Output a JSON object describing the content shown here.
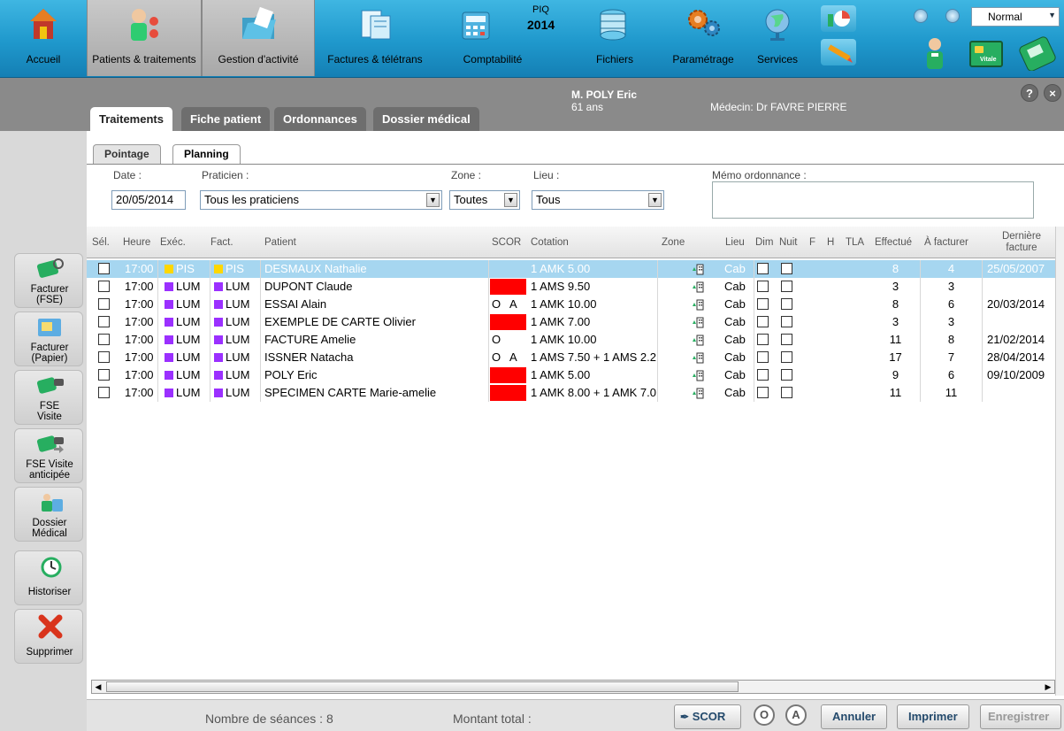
{
  "toolbar": {
    "items": [
      {
        "label": "Accueil"
      },
      {
        "label": "Patients & traitements"
      },
      {
        "label": "Gestion d'activité"
      },
      {
        "label": "Factures & télétrans"
      },
      {
        "label": "Comptabilité"
      },
      {
        "label": "Fichiers"
      },
      {
        "label": "Paramétrage"
      },
      {
        "label": "Services"
      }
    ],
    "piq_label": "PIQ",
    "piq_year": "2014",
    "mode": "Normal",
    "vitale_label": "Vitale"
  },
  "patient": {
    "name": "M. POLY Eric",
    "age": "61 ans",
    "doctor": "Médecin: Dr FAVRE PIERRE"
  },
  "header_buttons": {
    "help": "?",
    "close": "×"
  },
  "main_tabs": [
    {
      "label": "Traitements"
    },
    {
      "label": "Fiche patient"
    },
    {
      "label": "Ordonnances"
    },
    {
      "label": "Dossier médical"
    }
  ],
  "sub_tabs": [
    {
      "label": "Pointage"
    },
    {
      "label": "Planning"
    }
  ],
  "filters": {
    "date_label": "Date :",
    "date_value": "20/05/2014",
    "praticien_label": "Praticien :",
    "praticien_value": "Tous les praticiens",
    "zone_label": "Zone :",
    "zone_value": "Toutes",
    "lieu_label": "Lieu :",
    "lieu_value": "Tous",
    "memo_label": "Mémo ordonnance :"
  },
  "columns": {
    "sel": "Sél.",
    "heure": "Heure",
    "exec": "Exéc.",
    "fact": "Fact.",
    "patient": "Patient",
    "scor": "SCOR",
    "cotation": "Cotation",
    "zone": "Zone",
    "lieu": "Lieu",
    "dim": "Dim",
    "nuit": "Nuit",
    "f": "F",
    "h": "H",
    "tla": "TLA",
    "effectue": "Effectué",
    "a_facturer": "À facturer",
    "derniere_1": "Dernière",
    "derniere_2": "facture"
  },
  "rows": [
    {
      "heure": "17:00",
      "exec": "PIS",
      "fact": "PIS",
      "exec_color": "#ffd700",
      "patient": "DESMAUX Nathalie",
      "scor_o": "",
      "scor_a": "",
      "scor_red": false,
      "cotation": "1 AMK 5.00",
      "lieu": "Cab",
      "effectue": "8",
      "a_facturer": "4",
      "derniere": "25/05/2007",
      "selected": true
    },
    {
      "heure": "17:00",
      "exec": "LUM",
      "fact": "LUM",
      "exec_color": "#9b30ff",
      "patient": "DUPONT Claude",
      "scor_o": "",
      "scor_a": "",
      "scor_red": true,
      "cotation": "1 AMS 9.50",
      "lieu": "Cab",
      "effectue": "3",
      "a_facturer": "3",
      "derniere": "",
      "selected": false
    },
    {
      "heure": "17:00",
      "exec": "LUM",
      "fact": "LUM",
      "exec_color": "#9b30ff",
      "patient": "ESSAI Alain",
      "scor_o": "O",
      "scor_a": "A",
      "scor_red": false,
      "cotation": "1 AMK 10.00",
      "lieu": "Cab",
      "effectue": "8",
      "a_facturer": "6",
      "derniere": "20/03/2014",
      "selected": false
    },
    {
      "heure": "17:00",
      "exec": "LUM",
      "fact": "LUM",
      "exec_color": "#9b30ff",
      "patient": "EXEMPLE DE CARTE Olivier",
      "scor_o": "",
      "scor_a": "",
      "scor_red": true,
      "cotation": "1 AMK 7.00",
      "lieu": "Cab",
      "effectue": "3",
      "a_facturer": "3",
      "derniere": "",
      "selected": false
    },
    {
      "heure": "17:00",
      "exec": "LUM",
      "fact": "LUM",
      "exec_color": "#9b30ff",
      "patient": "FACTURE Amelie",
      "scor_o": "O",
      "scor_a": "",
      "scor_red": false,
      "cotation": "1 AMK 10.00",
      "lieu": "Cab",
      "effectue": "11",
      "a_facturer": "8",
      "derniere": "21/02/2014",
      "selected": false
    },
    {
      "heure": "17:00",
      "exec": "LUM",
      "fact": "LUM",
      "exec_color": "#9b30ff",
      "patient": "ISSNER Natacha",
      "scor_o": "O",
      "scor_a": "A",
      "scor_red": false,
      "cotation": "1 AMS 7.50 + 1 AMS 2.2",
      "lieu": "Cab",
      "effectue": "17",
      "a_facturer": "7",
      "derniere": "28/04/2014",
      "selected": false
    },
    {
      "heure": "17:00",
      "exec": "LUM",
      "fact": "LUM",
      "exec_color": "#9b30ff",
      "patient": "POLY Eric",
      "scor_o": "",
      "scor_a": "",
      "scor_red": true,
      "cotation": "1 AMK 5.00",
      "lieu": "Cab",
      "effectue": "9",
      "a_facturer": "6",
      "derniere": "09/10/2009",
      "selected": false
    },
    {
      "heure": "17:00",
      "exec": "LUM",
      "fact": "LUM",
      "exec_color": "#9b30ff",
      "patient": "SPECIMEN CARTE Marie-amelie",
      "scor_o": "",
      "scor_a": "",
      "scor_red": true,
      "cotation": "1 AMK 8.00 + 1 AMK 7.0",
      "lieu": "Cab",
      "effectue": "11",
      "a_facturer": "11",
      "derniere": "",
      "selected": false
    }
  ],
  "sidebar": [
    {
      "line1": "Facturer",
      "line2": "(FSE)"
    },
    {
      "line1": "Facturer",
      "line2": "(Papier)"
    },
    {
      "line1": "FSE",
      "line2": "Visite"
    },
    {
      "line1": "FSE Visite",
      "line2": "anticipée"
    },
    {
      "line1": "Dossier",
      "line2": "Médical"
    },
    {
      "line1": "Historiser",
      "line2": ""
    },
    {
      "line1": "Supprimer",
      "line2": ""
    }
  ],
  "footer": {
    "seances": "Nombre de séances : 8",
    "montant": "Montant total :",
    "scor": "SCOR",
    "o": "O",
    "a": "A",
    "annuler": "Annuler",
    "imprimer": "Imprimer",
    "enregistrer": "Enregistrer"
  }
}
